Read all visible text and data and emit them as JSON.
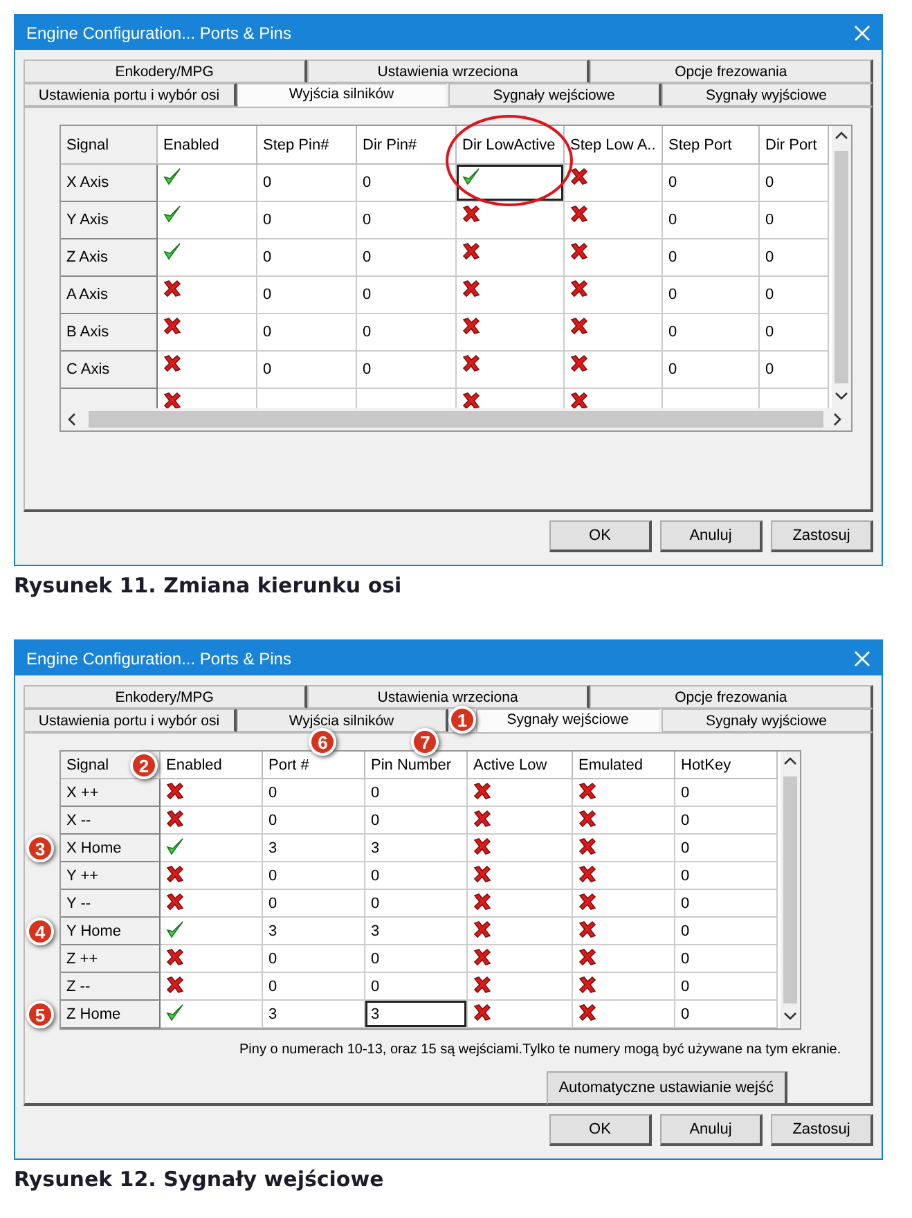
{
  "figures": [
    {
      "window": {
        "title": "Engine Configuration... Ports & Pins"
      },
      "tab_rows": [
        [
          {
            "label": "Enkodery/MPG",
            "selected": false
          },
          {
            "label": "Ustawienia wrzeciona",
            "selected": false
          },
          {
            "label": "Opcje frezowania",
            "selected": false
          }
        ],
        [
          {
            "label": "Ustawienia portu i wybór osi",
            "selected": false
          },
          {
            "label": "Wyjścia silników",
            "selected": true
          },
          {
            "label": "Sygnały wejściowe",
            "selected": false
          },
          {
            "label": "Sygnały wyjściowe",
            "selected": false
          }
        ]
      ],
      "grid": {
        "horizontal_scroll": true,
        "columns": [
          {
            "label": "Signal",
            "kind": "header",
            "focused": false,
            "circled": false
          },
          {
            "label": "Enabled",
            "kind": "check",
            "focused": false,
            "circled": false
          },
          {
            "label": "Step Pin#",
            "kind": "text",
            "focused": false,
            "circled": false
          },
          {
            "label": "Dir Pin#",
            "kind": "text",
            "focused": false,
            "circled": false
          },
          {
            "label": "Dir LowActive",
            "kind": "check",
            "focused": true,
            "circled": true
          },
          {
            "label": "Step Low A..",
            "kind": "check",
            "focused": false,
            "circled": false
          },
          {
            "label": "Step Port",
            "kind": "text",
            "focused": false,
            "circled": false
          },
          {
            "label": "Dir Port",
            "kind": "text",
            "focused": false,
            "circled": false
          }
        ],
        "rows": [
          {
            "selected": true,
            "cells": [
              "X Axis",
              true,
              "0",
              "0",
              true,
              false,
              "0",
              "0"
            ]
          },
          {
            "selected": false,
            "cells": [
              "Y Axis",
              true,
              "0",
              "0",
              false,
              false,
              "0",
              "0"
            ]
          },
          {
            "selected": false,
            "cells": [
              "Z Axis",
              true,
              "0",
              "0",
              false,
              false,
              "0",
              "0"
            ]
          },
          {
            "selected": false,
            "cells": [
              "A Axis",
              false,
              "0",
              "0",
              false,
              false,
              "0",
              "0"
            ]
          },
          {
            "selected": false,
            "cells": [
              "B Axis",
              false,
              "0",
              "0",
              false,
              false,
              "0",
              "0"
            ]
          },
          {
            "selected": false,
            "cells": [
              "C Axis",
              false,
              "0",
              "0",
              false,
              false,
              "0",
              "0"
            ]
          },
          {
            "selected": false,
            "cells": [
              null,
              false,
              null,
              null,
              false,
              false,
              null,
              null
            ]
          }
        ]
      },
      "buttons": [
        "OK",
        "Anuluj",
        "Zastosuj"
      ],
      "caption": "Rysunek 11. Zmiana kierunku osi"
    },
    {
      "window": {
        "title": "Engine Configuration... Ports & Pins"
      },
      "tab_rows": [
        [
          {
            "label": "Enkodery/MPG",
            "selected": false
          },
          {
            "label": "Ustawienia wrzeciona",
            "selected": false
          },
          {
            "label": "Opcje frezowania",
            "selected": false
          }
        ],
        [
          {
            "label": "Ustawienia portu i wybór osi",
            "selected": false
          },
          {
            "label": "Wyjścia silników",
            "selected": false
          },
          {
            "label": "Sygnały wejściowe",
            "selected": true,
            "callout": "1"
          },
          {
            "label": "Sygnały wyjściowe",
            "selected": false
          }
        ]
      ],
      "grid": {
        "horizontal_scroll": false,
        "columns": [
          {
            "label": "Signal",
            "kind": "header",
            "focused": false,
            "circled": false,
            "callout": "2"
          },
          {
            "label": "Enabled",
            "kind": "check",
            "focused": false,
            "circled": false
          },
          {
            "label": "Port #",
            "kind": "text",
            "focused": false,
            "circled": false,
            "callout": "6"
          },
          {
            "label": "Pin Number",
            "kind": "text",
            "focused": true,
            "circled": false,
            "callout": "7"
          },
          {
            "label": "Active Low",
            "kind": "check",
            "focused": false,
            "circled": false
          },
          {
            "label": "Emulated",
            "kind": "check",
            "focused": false,
            "circled": false
          },
          {
            "label": "HotKey",
            "kind": "text",
            "focused": false,
            "circled": false
          }
        ],
        "rows": [
          {
            "selected": false,
            "cells": [
              "X ++",
              false,
              "0",
              "0",
              false,
              false,
              "0"
            ]
          },
          {
            "selected": false,
            "cells": [
              "X --",
              false,
              "0",
              "0",
              false,
              false,
              "0"
            ]
          },
          {
            "selected": false,
            "callout": "3",
            "cells": [
              "X Home",
              true,
              "3",
              "3",
              false,
              false,
              "0"
            ]
          },
          {
            "selected": false,
            "cells": [
              "Y ++",
              false,
              "0",
              "0",
              false,
              false,
              "0"
            ]
          },
          {
            "selected": false,
            "cells": [
              "Y --",
              false,
              "0",
              "0",
              false,
              false,
              "0"
            ]
          },
          {
            "selected": false,
            "callout": "4",
            "cells": [
              "Y Home",
              true,
              "3",
              "3",
              false,
              false,
              "0"
            ]
          },
          {
            "selected": false,
            "cells": [
              "Z ++",
              false,
              "0",
              "0",
              false,
              false,
              "0"
            ]
          },
          {
            "selected": false,
            "cells": [
              "Z --",
              false,
              "0",
              "0",
              false,
              false,
              "0"
            ]
          },
          {
            "selected": true,
            "callout": "5",
            "cells": [
              "Z Home",
              true,
              "3",
              "3",
              false,
              false,
              "0"
            ]
          }
        ]
      },
      "note": "Piny o numerach 10-13, oraz 15 są wejściami.Tylko te numery mogą być używane na tym ekranie.",
      "action_button": "Automatyczne ustawianie wejść",
      "buttons": [
        "OK",
        "Anuluj",
        "Zastosuj"
      ],
      "caption": "Rysunek 12. Sygnały wejściowe"
    }
  ]
}
